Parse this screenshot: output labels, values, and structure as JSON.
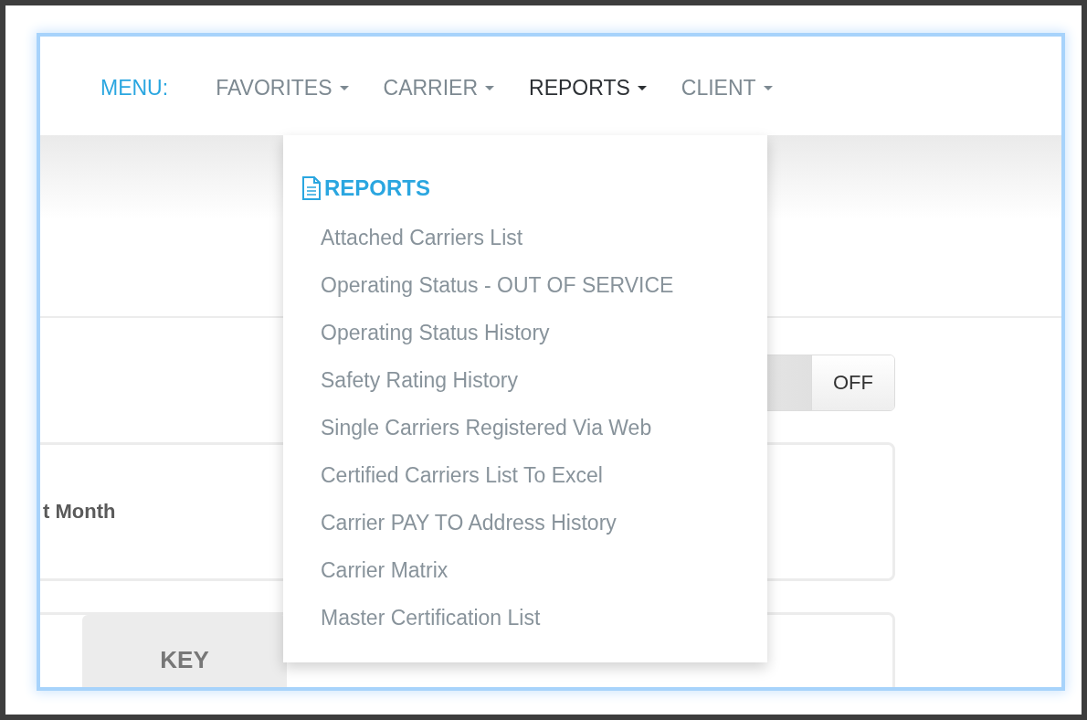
{
  "menu": {
    "label": "MENU:",
    "items": [
      {
        "label": "FAVORITES",
        "selected": false
      },
      {
        "label": "CARRIER",
        "selected": false
      },
      {
        "label": "REPORTS",
        "selected": true
      },
      {
        "label": "CLIENT",
        "selected": false
      }
    ]
  },
  "dropdown": {
    "header": "REPORTS",
    "items": [
      "Attached Carriers List",
      "Operating Status - OUT OF SERVICE",
      "Operating Status History",
      "Safety Rating History",
      "Single Carriers Registered Via Web",
      "Certified Carriers List To Excel",
      "Carrier PAY TO Address History",
      "Carrier Matrix",
      "Master Certification List"
    ]
  },
  "toggle": {
    "label": "OFF",
    "on": false
  },
  "filter_card": {
    "label": "t Month"
  },
  "key_card": {
    "tab": "KEY"
  }
}
